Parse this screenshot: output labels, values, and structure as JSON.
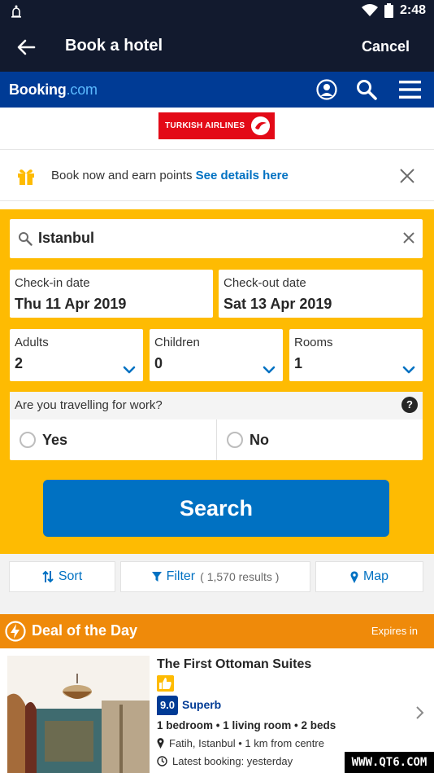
{
  "status_bar": {
    "time": "2:48"
  },
  "app_bar": {
    "title": "Book a hotel",
    "cancel_label": "Cancel"
  },
  "booking_bar": {
    "brand": "Booking",
    "brand_suffix": ".com"
  },
  "partner": {
    "name": "TURKISH AIRLINES"
  },
  "promo": {
    "text": "Book now and earn points",
    "link": "See details here"
  },
  "search": {
    "destination": "Istanbul",
    "checkin_label": "Check-in date",
    "checkin_value": "Thu 11 Apr 2019",
    "checkout_label": "Check-out date",
    "checkout_value": "Sat 13 Apr 2019",
    "adults_label": "Adults",
    "adults_value": "2",
    "children_label": "Children",
    "children_value": "0",
    "rooms_label": "Rooms",
    "rooms_value": "1",
    "work_question": "Are you travelling for work?",
    "help_glyph": "?",
    "yes_label": "Yes",
    "no_label": "No",
    "button_label": "Search"
  },
  "tools": {
    "sort_label": "Sort",
    "filter_label": "Filter",
    "filter_count": "( 1,570 results )",
    "map_label": "Map"
  },
  "deal": {
    "title": "Deal of the Day",
    "expires": "Expires in"
  },
  "hotel": {
    "name": "The First Ottoman Suites",
    "score": "9.0",
    "score_word": "Superb",
    "rooms": "1 bedroom • 1 living room • 2 beds",
    "location": "Fatih, Istanbul • 1 km from centre",
    "latest_booking": "Latest booking: yesterday"
  },
  "watermark": "WWW.QT6.COM",
  "colors": {
    "app_bar": "#121a2e",
    "brand_blue": "#003b95",
    "search_yellow": "#febb02",
    "action_blue": "#0071c2",
    "deal_orange": "#ef8a0a"
  }
}
